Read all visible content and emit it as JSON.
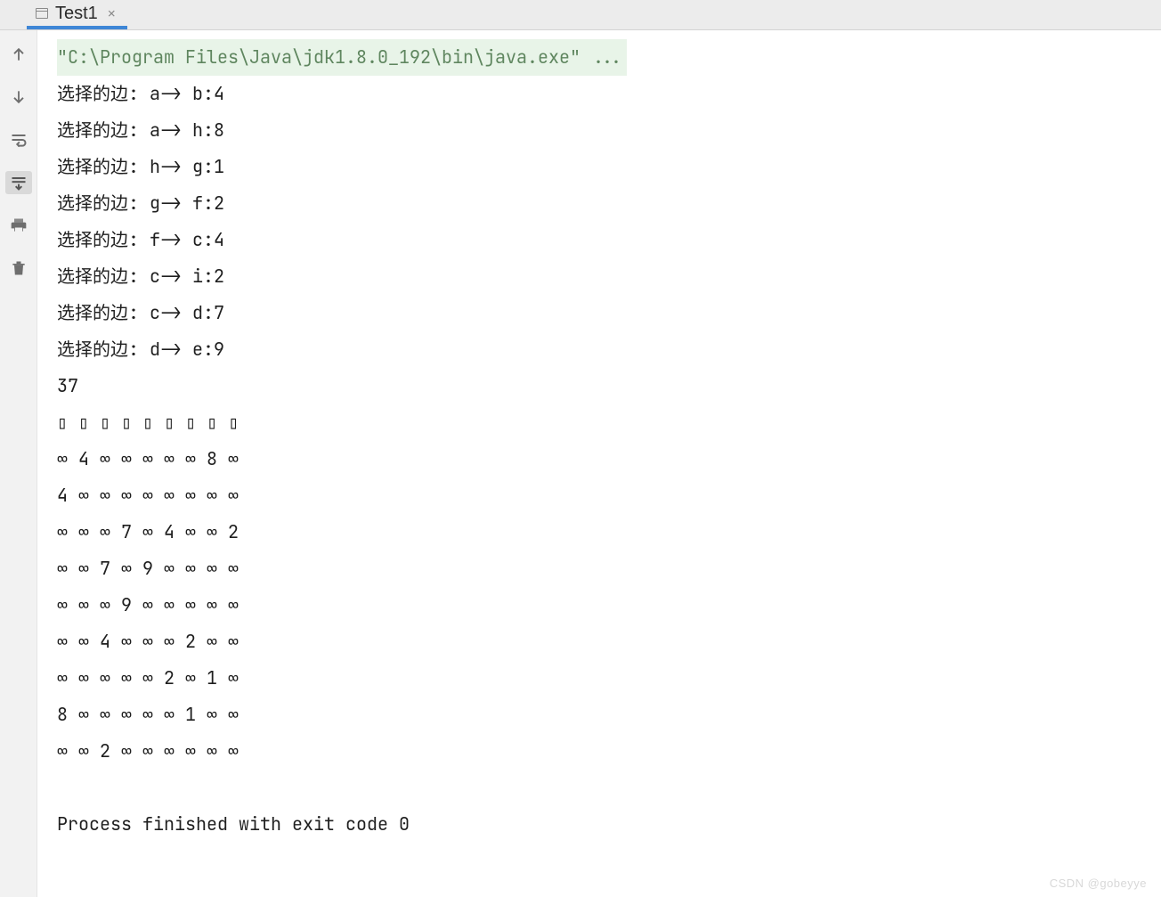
{
  "tab": {
    "label": "Test1",
    "close_glyph": "×"
  },
  "console": {
    "command_line": "\"C:\\Program Files\\Java\\jdk1.8.0_192\\bin\\java.exe\" ...",
    "edges": [
      {
        "prefix": "选择的边: ",
        "detail": "a-> b:4"
      },
      {
        "prefix": "选择的边: ",
        "detail": "a-> h:8"
      },
      {
        "prefix": "选择的边: ",
        "detail": "h-> g:1"
      },
      {
        "prefix": "选择的边: ",
        "detail": "g-> f:2"
      },
      {
        "prefix": "选择的边: ",
        "detail": "f-> c:4"
      },
      {
        "prefix": "选择的边: ",
        "detail": "c-> i:2"
      },
      {
        "prefix": "选择的边: ",
        "detail": "c-> d:7"
      },
      {
        "prefix": "选择的边: ",
        "detail": "d-> e:9"
      }
    ],
    "total": "37",
    "header_row": "▯ ▯ ▯ ▯ ▯ ▯ ▯ ▯ ▯",
    "matrix": [
      "∞ 4 ∞ ∞ ∞ ∞ ∞ 8 ∞",
      "4 ∞ ∞ ∞ ∞ ∞ ∞ ∞ ∞",
      "∞ ∞ ∞ 7 ∞ 4 ∞ ∞ 2",
      "∞ ∞ 7 ∞ 9 ∞ ∞ ∞ ∞",
      "∞ ∞ ∞ 9 ∞ ∞ ∞ ∞ ∞",
      "∞ ∞ 4 ∞ ∞ ∞ 2 ∞ ∞",
      "∞ ∞ ∞ ∞ ∞ 2 ∞ 1 ∞",
      "8 ∞ ∞ ∞ ∞ ∞ 1 ∞ ∞",
      "∞ ∞ 2 ∞ ∞ ∞ ∞ ∞ ∞"
    ],
    "exit_line": "Process finished with exit code 0"
  },
  "watermark": "CSDN @gobeyye",
  "icons": {
    "up": "arrow-up-icon",
    "down": "arrow-down-icon",
    "wrap": "soft-wrap-icon",
    "scroll_end": "scroll-to-end-icon",
    "print": "print-icon",
    "trash": "trash-icon"
  }
}
